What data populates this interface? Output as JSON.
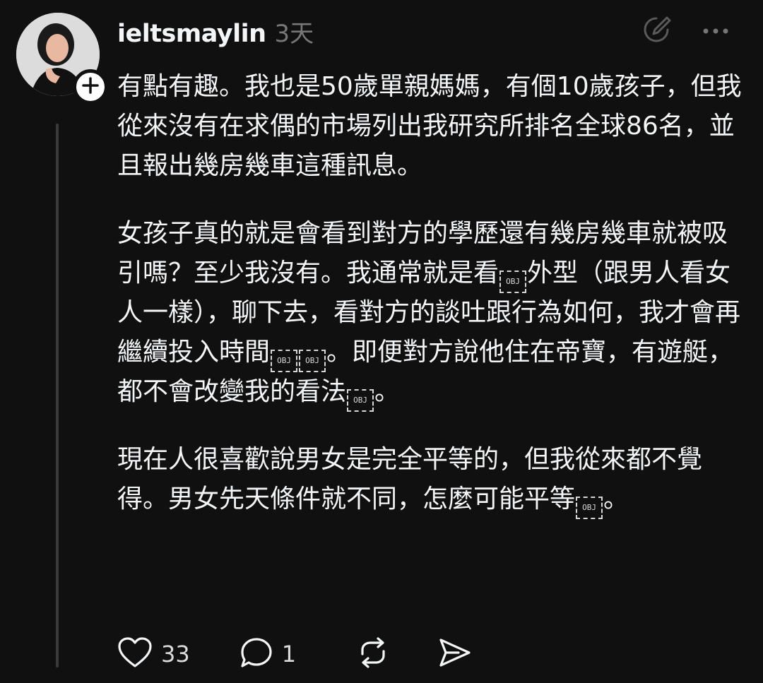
{
  "post": {
    "username": "ieltsmaylin",
    "timestamp": "3天",
    "paragraphs": [
      [
        {
          "t": "有點有趣。我也是50歲單親媽媽，有個10歲孩子，但我從來沒有在求偶的市場列出我研究所排名全球86名，並且報出幾房幾車這種訊息。"
        }
      ],
      [
        {
          "t": "女孩子真的就是會看到對方的學歷還有幾房幾車就被吸引嗎？至少我沒有。我通常就是看"
        },
        {
          "obj": true
        },
        {
          "t": "外型（跟男人看女人一樣），聊下去，看對方的談吐跟行為如何，我才會再繼續投入時間"
        },
        {
          "obj": true
        },
        {
          "obj": true
        },
        {
          "t": "。即便對方說他住在帝寶，有遊艇，都不會改變我的看法"
        },
        {
          "obj": true
        },
        {
          "t": "。"
        }
      ],
      [
        {
          "t": "現在人很喜歡說男女是完全平等的，但我從來都不覺得。男女先天條件就不同，怎麼可能平等"
        },
        {
          "obj": true
        },
        {
          "t": "。"
        }
      ]
    ],
    "obj_placeholder": "OBJ"
  },
  "actions": {
    "likes": "33",
    "replies": "1"
  },
  "icons": {
    "follow": "plus-icon",
    "edit": "edit-circle-icon",
    "more": "more-dots-icon",
    "like": "heart-icon",
    "reply": "comment-icon",
    "repost": "repost-icon",
    "share": "send-icon"
  },
  "colors": {
    "background": "#101010",
    "text": "#f3f5f7",
    "muted": "#777777",
    "thread_line": "#3a3a3a"
  }
}
